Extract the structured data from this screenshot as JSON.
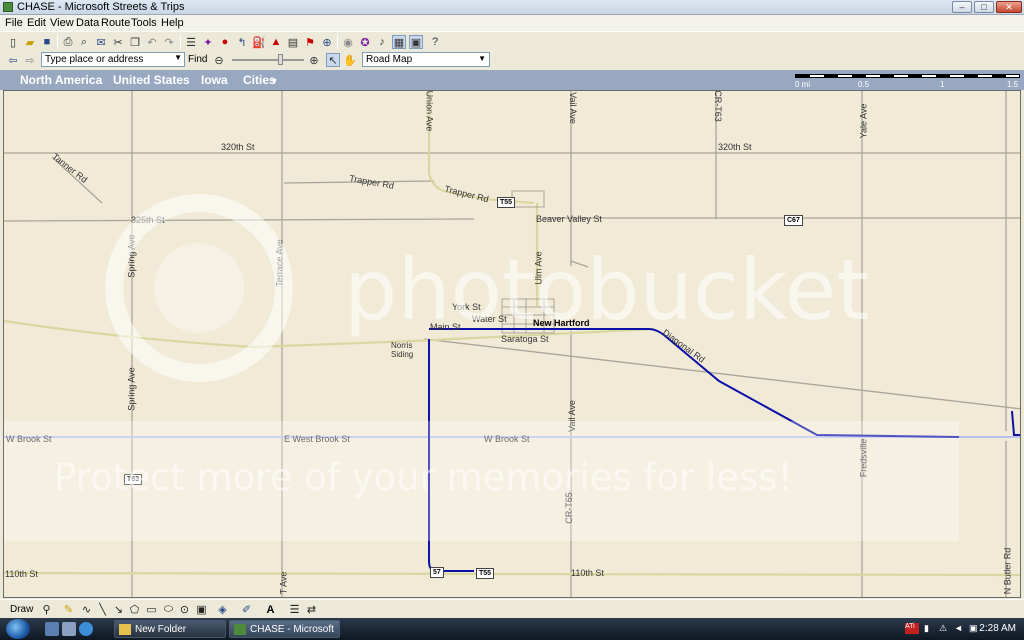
{
  "window": {
    "title": "CHASE - Microsoft Streets & Trips"
  },
  "menu": [
    "File",
    "Edit",
    "View",
    "Data",
    "Route",
    "Tools",
    "Help"
  ],
  "search": {
    "placeholder": "Type place or address",
    "find_label": "Find"
  },
  "map_style": {
    "selected": "Road Map"
  },
  "breadcrumb": [
    "North America",
    "United States",
    "Iowa",
    "Cities"
  ],
  "scale": {
    "labels": [
      "0 mi",
      "0.5",
      "1",
      "1.5"
    ]
  },
  "map": {
    "street_labels": [
      "320th St",
      "Tanner Rd",
      "Trapper Rd",
      "Trapper Rd",
      "Union Ave",
      "Vail Ave",
      "CR-T63",
      "Yale Ave",
      "320th St",
      "325th St",
      "Beaver Valley St",
      "Spring Ave",
      "Terrace Ave",
      "Ulm Ave",
      "York St",
      "Water St",
      "Main St",
      "Saratoga St",
      "Diagonal Rd",
      "Norris Siding",
      "Spring Ave",
      "W Brook St",
      "E West Brook St",
      "W Brook St",
      "Vail Ave",
      "CR-T65",
      "Fredsville",
      "110th St",
      "110th St",
      "T Ave",
      "N Butler Rd"
    ],
    "town": "New Hartford",
    "shields": [
      "T55",
      "C67",
      "T63",
      "T55",
      "57"
    ]
  },
  "watermark": {
    "logo": "photobucket",
    "tagline": "Protect more of your memories for less!"
  },
  "drawbar": {
    "label": "Draw"
  },
  "taskbar": {
    "tasks": [
      "New Folder",
      "CHASE - Microsoft ..."
    ],
    "clock": "2:28 AM"
  },
  "colors": {
    "route": "#0d10a8",
    "map_bg": "#f1ead7",
    "breadcrumb": "#98a8c0"
  }
}
